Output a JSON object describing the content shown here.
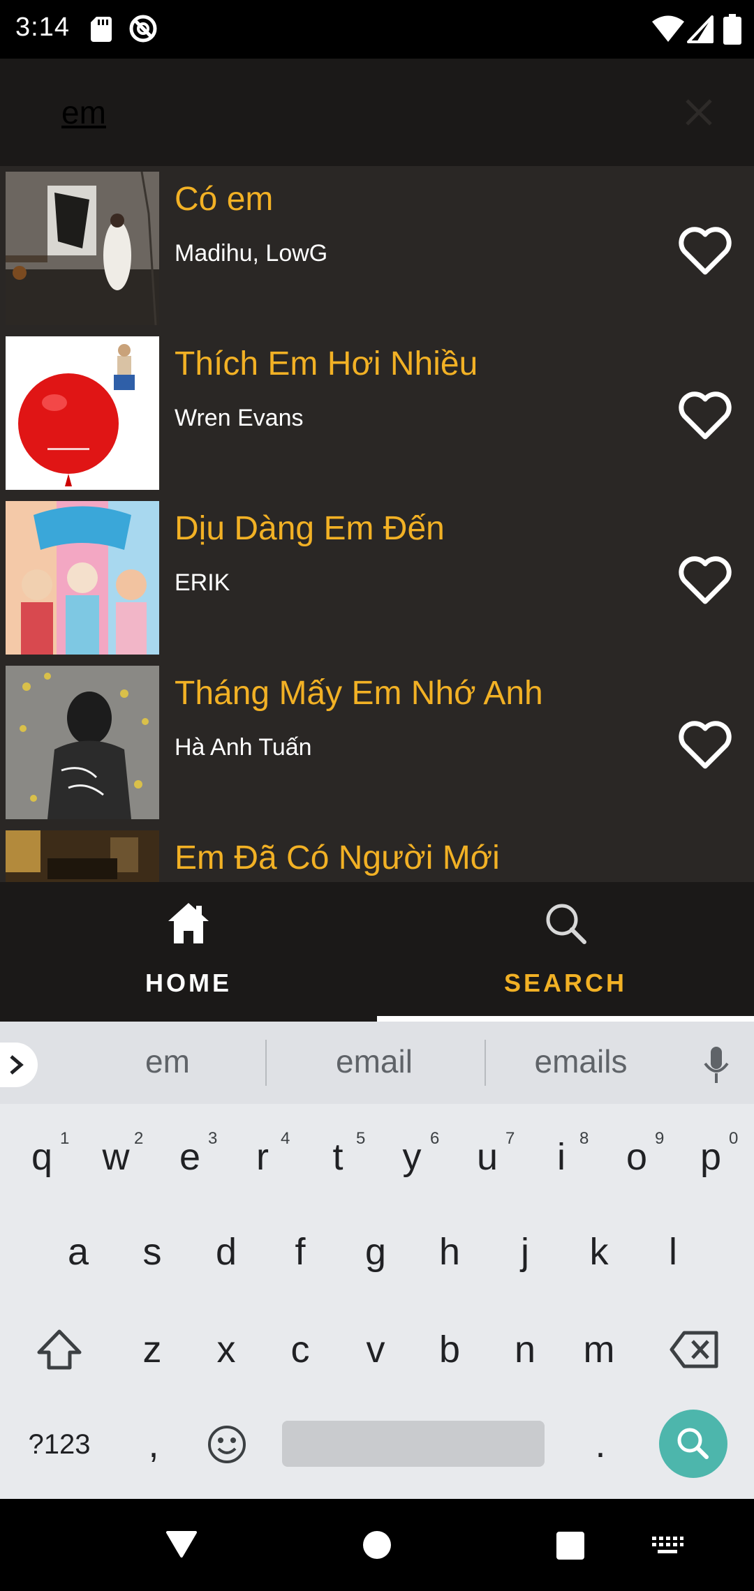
{
  "status_bar": {
    "time": "3:14"
  },
  "search": {
    "query": "em"
  },
  "songs": [
    {
      "title": "Có em",
      "artist": "Madihu, LowG"
    },
    {
      "title": "Thích Em Hơi Nhiều",
      "artist": "Wren Evans"
    },
    {
      "title": "Dịu Dàng Em Đến",
      "artist": "ERIK"
    },
    {
      "title": "Tháng Mấy Em Nhớ Anh",
      "artist": "Hà Anh Tuấn"
    },
    {
      "title": "Em Đã Có Người Mới",
      "artist": ""
    }
  ],
  "bottom_nav": {
    "home_label": "HOME",
    "search_label": "SEARCH",
    "active": "search"
  },
  "keyboard": {
    "suggestions": [
      "em",
      "email",
      "emails"
    ],
    "row1": [
      "q",
      "w",
      "e",
      "r",
      "t",
      "y",
      "u",
      "i",
      "o",
      "p"
    ],
    "row1_hints": [
      "1",
      "2",
      "3",
      "4",
      "5",
      "6",
      "7",
      "8",
      "9",
      "0"
    ],
    "row2": [
      "a",
      "s",
      "d",
      "f",
      "g",
      "h",
      "j",
      "k",
      "l"
    ],
    "row3": [
      "z",
      "x",
      "c",
      "v",
      "b",
      "n",
      "m"
    ],
    "symbols_label": "?123",
    "comma": ",",
    "period": "."
  },
  "colors": {
    "title": "#f2b125",
    "list_bg": "#2a2725",
    "nav_bg": "#1b1918",
    "search_key": "#4db6ac"
  }
}
